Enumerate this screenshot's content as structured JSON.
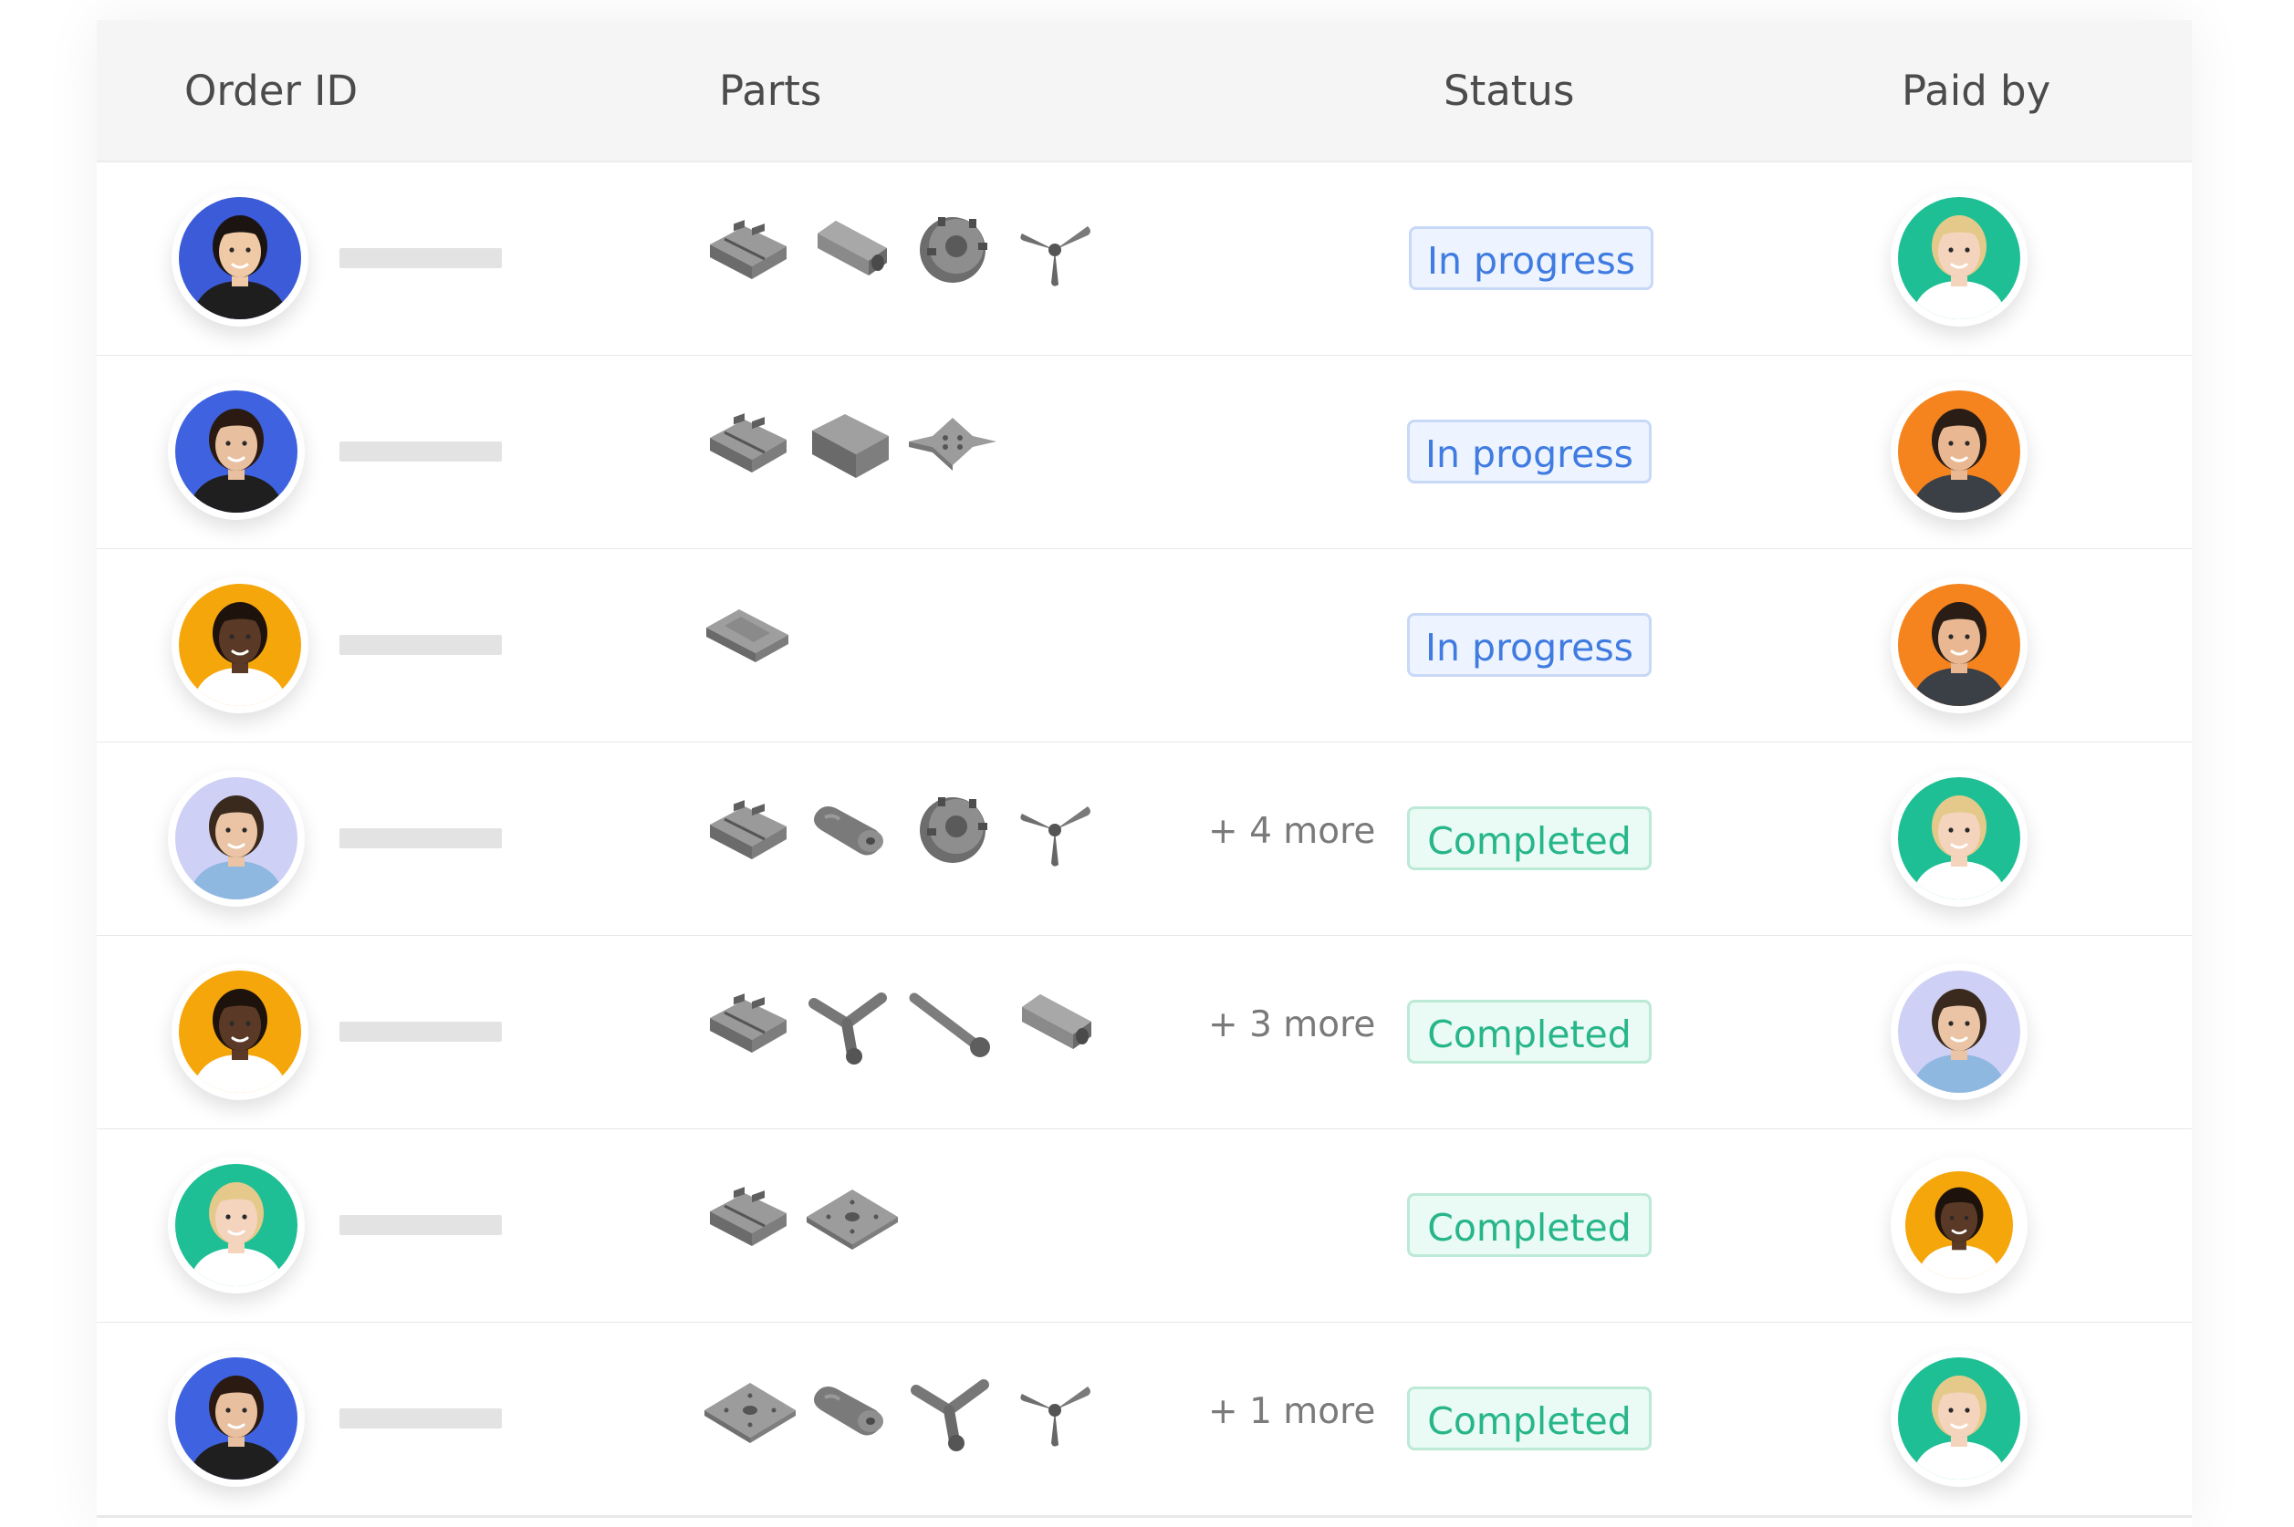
{
  "table": {
    "columns": {
      "order_id": "Order ID",
      "parts": "Parts",
      "status": "Status",
      "paid_by": "Paid by"
    },
    "rows": [
      {
        "customer": {
          "skin": "#f0c9a6",
          "hair": "#1b1411",
          "bg": "#3b5bd9",
          "shirt": "#1e1e1e"
        },
        "parts": [
          "enclosure-part",
          "hex-standoff-part",
          "motor-part",
          "propeller-part"
        ],
        "more_label": "",
        "status": "In progress",
        "status_type": "progress",
        "payer": {
          "skin": "#f4d4bd",
          "hair": "#e5c98a",
          "bg": "#1fbf95",
          "shirt": "#ffffff"
        }
      },
      {
        "customer": {
          "skin": "#e8bf9f",
          "hair": "#2a1a12",
          "bg": "#3f63e0",
          "shirt": "#1f1f1f"
        },
        "parts": [
          "enclosure-part",
          "block-part",
          "frame-plate-part"
        ],
        "more_label": "",
        "status": "In progress",
        "status_type": "progress",
        "payer": {
          "skin": "#e9b893",
          "hair": "#2a1d15",
          "bg": "#f5841f",
          "shirt": "#3b3f46"
        }
      },
      {
        "customer": {
          "skin": "#5a3a26",
          "hair": "#1d120c",
          "bg": "#f5a60b",
          "shirt": "#ffffff"
        },
        "parts": [
          "board-part"
        ],
        "more_label": "",
        "status": "In progress",
        "status_type": "progress",
        "payer": {
          "skin": "#e9b893",
          "hair": "#2a1d15",
          "bg": "#f5841f",
          "shirt": "#3b3f46"
        }
      },
      {
        "customer": {
          "skin": "#eac4a4",
          "hair": "#3a2a1e",
          "bg": "#cfd0f5",
          "shirt": "#8fb8e0"
        },
        "parts": [
          "enclosure-part",
          "roller-part",
          "motor-part",
          "propeller-part"
        ],
        "more_label": "+ 4 more",
        "status": "Completed",
        "status_type": "done",
        "payer": {
          "skin": "#f4d4bd",
          "hair": "#e5c98a",
          "bg": "#1fbf95",
          "shirt": "#ffffff"
        }
      },
      {
        "customer": {
          "skin": "#5a3a26",
          "hair": "#1d120c",
          "bg": "#f5a60b",
          "shirt": "#ffffff"
        },
        "parts": [
          "enclosure-part",
          "bracket-part",
          "bolt-part",
          "hex-standoff-part"
        ],
        "more_label": "+ 3 more",
        "status": "Completed",
        "status_type": "done",
        "payer": {
          "skin": "#eac4a4",
          "hair": "#3a2a1e",
          "bg": "#cfd0f5",
          "shirt": "#8fb8e0"
        }
      },
      {
        "customer": {
          "skin": "#f4d4bd",
          "hair": "#e5c98a",
          "bg": "#1fbf95",
          "shirt": "#ffffff"
        },
        "parts": [
          "enclosure-part",
          "square-plate-part"
        ],
        "more_label": "",
        "status": "Completed",
        "status_type": "done",
        "payer": {
          "skin": "#5a3a26",
          "hair": "#1d120c",
          "bg": "#f5a60b",
          "shirt": "#ffffff"
        }
      },
      {
        "customer": {
          "skin": "#e8bf9f",
          "hair": "#2a1a12",
          "bg": "#3f63e0",
          "shirt": "#1f1f1f"
        },
        "parts": [
          "square-plate-part",
          "roller-part",
          "bracket-part",
          "propeller-part"
        ],
        "more_label": "+ 1 more",
        "status": "Completed",
        "status_type": "done",
        "payer": {
          "skin": "#f4d4bd",
          "hair": "#e5c98a",
          "bg": "#1fbf95",
          "shirt": "#ffffff"
        }
      }
    ]
  }
}
